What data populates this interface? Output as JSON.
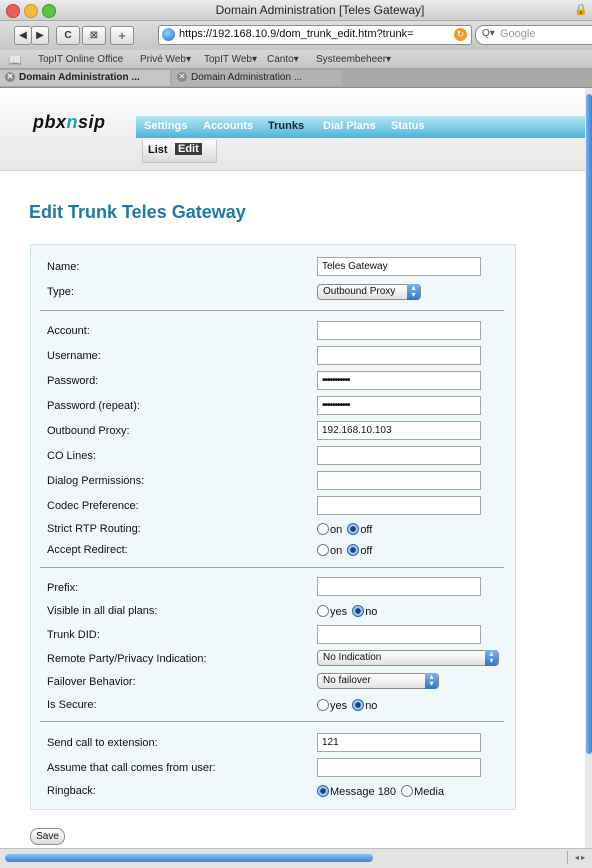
{
  "window": {
    "title": "Domain Administration [Teles Gateway]"
  },
  "toolbar": {
    "back": "◀",
    "forward": "▶",
    "reload": "C",
    "snapback": "⊠",
    "add": "+",
    "url": "https://192.168.10.9/dom_trunk_edit.htm?trunk=",
    "search_placeholder": "Google"
  },
  "bookmarks": [
    "TopIT Online Office",
    "Privé Web▾",
    "TopIT Web▾",
    "Canto▾",
    "Systeembeheer▾"
  ],
  "tabs": [
    "Domain Administration ...",
    "Domain Administration ..."
  ],
  "app": {
    "logo": {
      "pre": "pbx",
      "mid": "n",
      "post": "sip"
    },
    "nav": [
      "Settings",
      "Accounts",
      "Trunks",
      "Dial Plans",
      "Status"
    ],
    "subnav": {
      "list": "List",
      "edit": "Edit"
    }
  },
  "page_title": "Edit Trunk Teles Gateway",
  "form": {
    "name": {
      "label": "Name:",
      "value": "Teles Gateway"
    },
    "type": {
      "label": "Type:",
      "value": "Outbound Proxy"
    },
    "account": {
      "label": "Account:",
      "value": ""
    },
    "username": {
      "label": "Username:",
      "value": ""
    },
    "password": {
      "label": "Password:",
      "value": "•••••••••••"
    },
    "password_repeat": {
      "label": "Password (repeat):",
      "value": "•••••••••••"
    },
    "outbound_proxy": {
      "label": "Outbound Proxy:",
      "value": "192.168.10.103"
    },
    "co_lines": {
      "label": "CO Lines:",
      "value": ""
    },
    "dialog_permissions": {
      "label": "Dialog Permissions:",
      "value": ""
    },
    "codec_preference": {
      "label": "Codec Preference:",
      "value": ""
    },
    "strict_rtp": {
      "label": "Strict RTP Routing:",
      "opt1": "on",
      "opt2": "off",
      "selected": "off"
    },
    "accept_redirect": {
      "label": "Accept Redirect:",
      "opt1": "on",
      "opt2": "off",
      "selected": "off"
    },
    "prefix": {
      "label": "Prefix:",
      "value": ""
    },
    "visible_all": {
      "label": "Visible in all dial plans:",
      "opt1": "yes",
      "opt2": "no",
      "selected": "no"
    },
    "trunk_did": {
      "label": "Trunk DID:",
      "value": ""
    },
    "remote_party": {
      "label": "Remote Party/Privacy Indication:",
      "value": "No Indication"
    },
    "failover": {
      "label": "Failover Behavior:",
      "value": "No failover"
    },
    "is_secure": {
      "label": "Is Secure:",
      "opt1": "yes",
      "opt2": "no",
      "selected": "no"
    },
    "send_ext": {
      "label": "Send call to extension:",
      "value": "121"
    },
    "assume_user": {
      "label": "Assume that call comes from user:",
      "value": ""
    },
    "ringback": {
      "label": "Ringback:",
      "opt1": "Message 180",
      "opt2": "Media",
      "selected": "Message 180"
    }
  },
  "save_label": "Save"
}
